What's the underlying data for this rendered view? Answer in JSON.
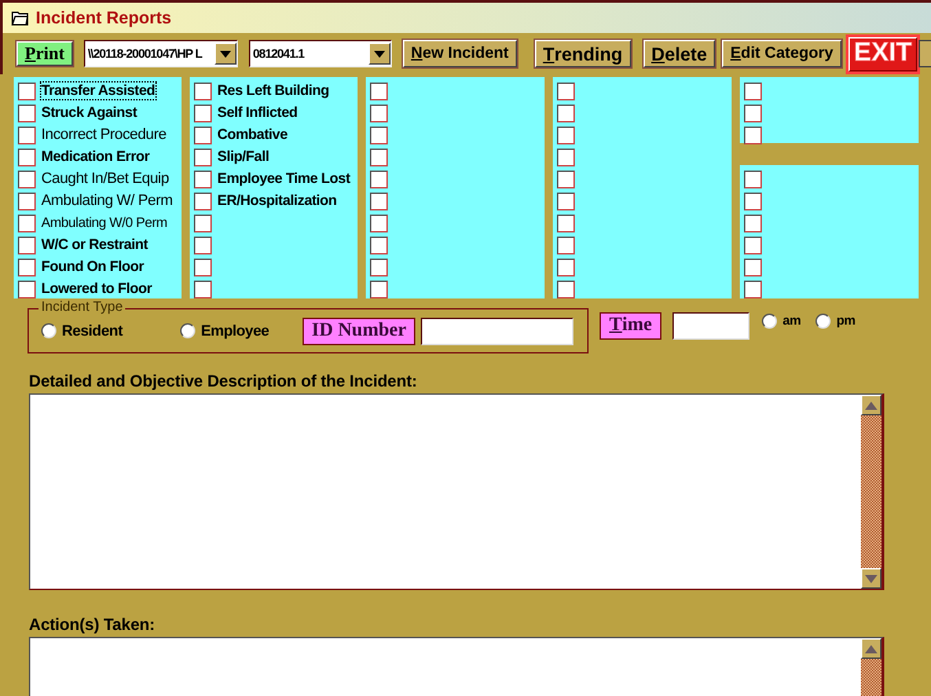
{
  "window": {
    "title": "Incident Reports"
  },
  "toolbar": {
    "print": {
      "label": "Print",
      "underline_first": true
    },
    "combos": [
      {
        "value": "\\\\20118-20001047\\HP L"
      },
      {
        "value": "0812041.1"
      }
    ],
    "buttons": [
      {
        "label": "New Incident",
        "underline_first": true,
        "kind": "normal"
      },
      {
        "label": "Trending",
        "underline_first": true,
        "kind": "large"
      },
      {
        "label": "Delete",
        "underline_first": true,
        "kind": "large"
      },
      {
        "label": "Edit Category",
        "underline_first": true,
        "kind": "normal"
      },
      {
        "label": "EXIT",
        "underline_first": false,
        "kind": "exit"
      }
    ]
  },
  "panels": [
    {
      "kind": "list",
      "items": [
        {
          "label": "Transfer Assisted",
          "kind": "bold",
          "checked": false,
          "focused": true
        },
        {
          "label": "Struck Against",
          "kind": "bold",
          "checked": false,
          "focused": false
        },
        {
          "label": "Incorrect Procedure",
          "kind": "regular",
          "checked": false,
          "focused": false
        },
        {
          "label": "Medication Error",
          "kind": "bold",
          "checked": false,
          "focused": false
        },
        {
          "label": "Caught In/Bet Equip",
          "kind": "regular",
          "checked": false,
          "focused": false
        },
        {
          "label": "Ambulating W/ Perm",
          "kind": "regular",
          "checked": false,
          "focused": false
        },
        {
          "label": "Ambulating W/0 Perm",
          "kind": "small",
          "checked": false,
          "focused": false
        },
        {
          "label": "W/C or Restraint",
          "kind": "bold",
          "checked": false,
          "focused": false
        },
        {
          "label": "Found On Floor",
          "kind": "bold",
          "checked": false,
          "focused": false
        },
        {
          "label": "Lowered to Floor",
          "kind": "bold",
          "checked": false,
          "focused": false
        }
      ]
    },
    {
      "kind": "list",
      "items": [
        {
          "label": "Res Left Building",
          "kind": "bold",
          "checked": false,
          "focused": false
        },
        {
          "label": "Self Inflicted",
          "kind": "bold",
          "checked": false,
          "focused": false
        },
        {
          "label": "Combative",
          "kind": "bold",
          "checked": false,
          "focused": false
        },
        {
          "label": "Slip/Fall",
          "kind": "bold",
          "checked": false,
          "focused": false
        },
        {
          "label": "Employee Time Lost",
          "kind": "bold",
          "checked": false,
          "focused": false
        },
        {
          "label": "ER/Hospitalization",
          "kind": "bold",
          "checked": false,
          "focused": false
        },
        {
          "checked": false
        },
        {
          "checked": false
        },
        {
          "checked": false
        },
        {
          "checked": false
        }
      ]
    },
    {
      "kind": "list",
      "items": [
        {
          "checked": false
        },
        {
          "checked": false
        },
        {
          "checked": false
        },
        {
          "checked": false
        },
        {
          "checked": false
        },
        {
          "checked": false
        },
        {
          "checked": false
        },
        {
          "checked": false
        },
        {
          "checked": false
        },
        {
          "checked": false
        }
      ]
    },
    {
      "kind": "list",
      "items": [
        {
          "checked": false
        },
        {
          "checked": false
        },
        {
          "checked": false
        },
        {
          "checked": false
        },
        {
          "checked": false
        },
        {
          "checked": false
        },
        {
          "checked": false
        },
        {
          "checked": false
        },
        {
          "checked": false
        },
        {
          "checked": false
        }
      ]
    },
    {
      "kind": "split",
      "sections": [
        {
          "items": [
            {
              "checked": false
            },
            {
              "checked": false
            },
            {
              "checked": false
            }
          ]
        },
        {
          "items": [
            {
              "checked": false
            },
            {
              "checked": false
            },
            {
              "checked": false
            },
            {
              "checked": false
            },
            {
              "checked": false
            },
            {
              "checked": false
            }
          ]
        }
      ]
    }
  ],
  "incident_type": {
    "legend": "Incident Type",
    "options": [
      {
        "label": "Resident",
        "selected": false
      },
      {
        "label": "Employee",
        "selected": false
      }
    ],
    "id_label": "ID Number"
  },
  "time": {
    "label": "Time",
    "underline_first": true,
    "options": [
      {
        "label": "am",
        "selected": false
      },
      {
        "label": "pm",
        "selected": false
      }
    ]
  },
  "description": {
    "label": "Detailed and Objective Description of the Incident:"
  },
  "actions": {
    "label": "Action(s) Taken:"
  }
}
